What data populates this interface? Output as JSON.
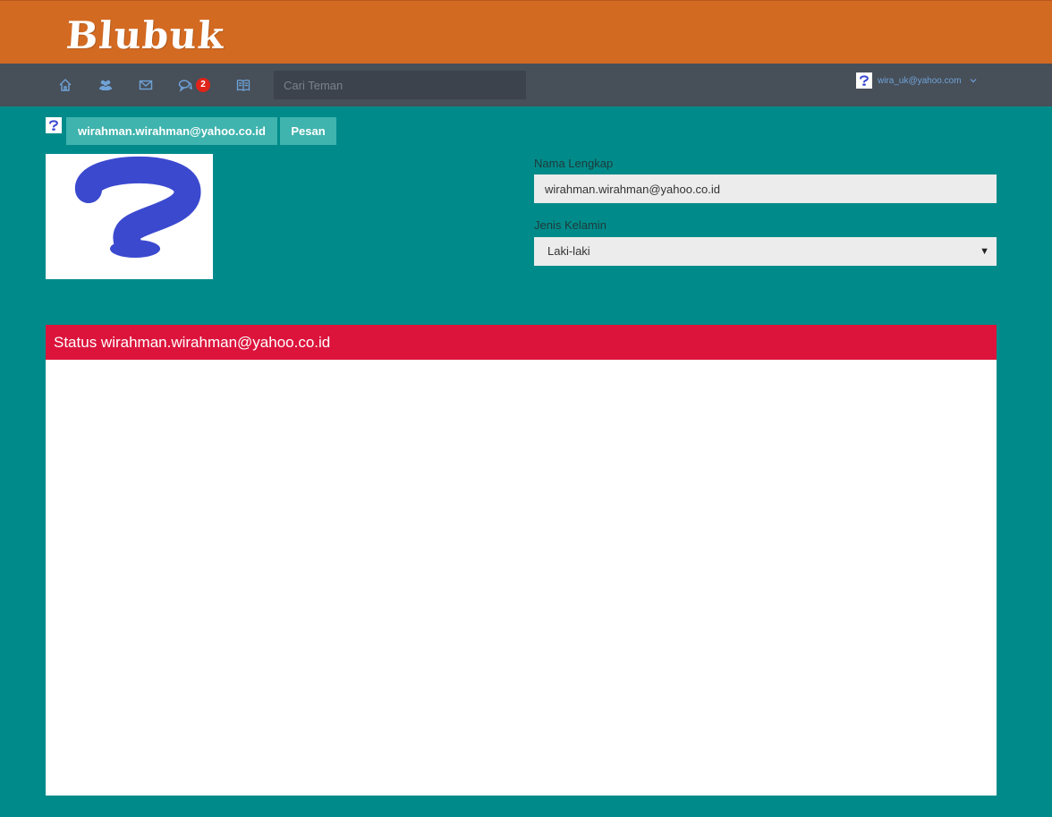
{
  "header": {
    "logo_text": "Blubuk",
    "brand_color": "#d36a22"
  },
  "navbar": {
    "icons": [
      "home-icon",
      "friends-icon",
      "mail-icon",
      "chat-icon",
      "book-icon"
    ],
    "chat_badge": "2",
    "search_placeholder": "Cari Teman",
    "user_email": "wira_uk@yahoo.com"
  },
  "profile": {
    "name_button": "wirahman.wirahman@yahoo.co.id",
    "message_button": "Pesan",
    "fields": {
      "nama_label": "Nama Lengkap",
      "nama_value": "wirahman.wirahman@yahoo.co.id",
      "jenis_label": "Jenis Kelamin",
      "jenis_value": "Laki-laki"
    }
  },
  "status": {
    "title": "Status wirahman.wirahman@yahoo.co.id",
    "header_color": "#dc143c"
  }
}
